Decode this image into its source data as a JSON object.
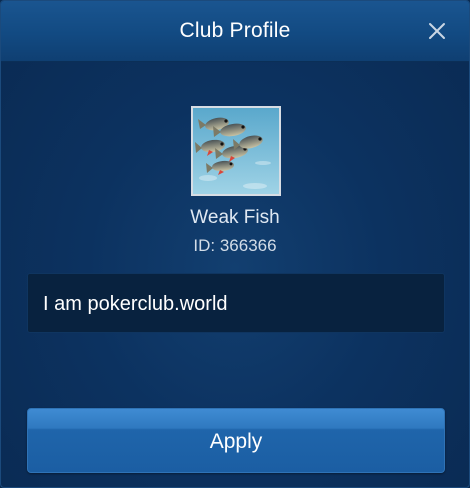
{
  "dialog": {
    "title": "Club Profile",
    "close_icon": "close-icon"
  },
  "club": {
    "avatar_icon": "fish-avatar",
    "name": "Weak Fish",
    "id_text": "ID: 366366",
    "description": "I am pokerclub.world"
  },
  "actions": {
    "apply_label": "Apply"
  },
  "colors": {
    "header": "#124a82",
    "background": "#0c3260",
    "input_background": "#08223f",
    "button": "#2f79c0",
    "text": "#ffffff"
  }
}
